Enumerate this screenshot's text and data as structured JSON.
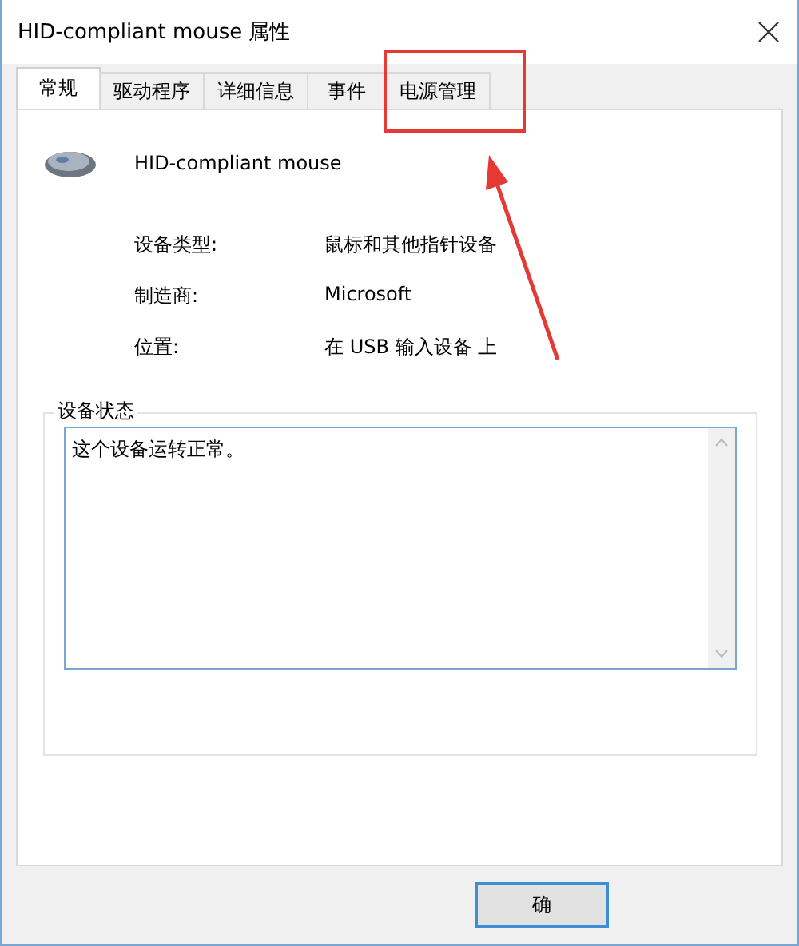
{
  "window": {
    "title": "HID-compliant mouse 属性"
  },
  "tabs": [
    {
      "label": "常规",
      "selected": true,
      "highlighted": false
    },
    {
      "label": "驱动程序",
      "selected": false,
      "highlighted": false
    },
    {
      "label": "详细信息",
      "selected": false,
      "highlighted": false
    },
    {
      "label": "事件",
      "selected": false,
      "highlighted": false
    },
    {
      "label": "电源管理",
      "selected": false,
      "highlighted": true
    }
  ],
  "device": {
    "name": "HID-compliant mouse"
  },
  "properties": [
    {
      "label": "设备类型:",
      "value": "鼠标和其他指针设备"
    },
    {
      "label": "制造商:",
      "value": "Microsoft"
    },
    {
      "label": "位置:",
      "value": "在 USB 输入设备 上"
    }
  ],
  "status_group": {
    "title": "设备状态",
    "text": "这个设备运转正常。"
  },
  "buttons": [
    "确"
  ]
}
